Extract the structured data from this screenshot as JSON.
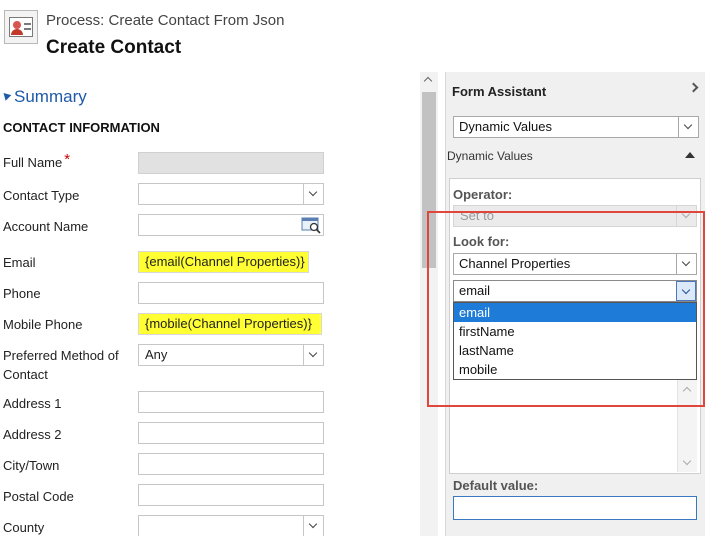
{
  "header": {
    "process_title": "Process: Create Contact From Json",
    "page_title": "Create Contact"
  },
  "summary": {
    "title": "Summary",
    "section_title": "CONTACT INFORMATION"
  },
  "fields": [
    {
      "label": "Full Name",
      "required": true,
      "type": "text",
      "value": "",
      "disabled": true
    },
    {
      "label": "Contact Type",
      "type": "select",
      "value": ""
    },
    {
      "label": "Account Name",
      "type": "lookup",
      "value": ""
    },
    {
      "label": "Email",
      "type": "text",
      "value": "{email(Channel Properties)}",
      "highlighted": true
    },
    {
      "label": "Phone",
      "type": "text",
      "value": ""
    },
    {
      "label": "Mobile Phone",
      "type": "text",
      "value": "{mobile(Channel Properties)}",
      "highlighted": true
    },
    {
      "label_line1": "Preferred Method of",
      "label_line2": "Contact",
      "type": "select",
      "value": "Any"
    },
    {
      "label": "Address 1",
      "type": "text",
      "value": ""
    },
    {
      "label": "Address 2",
      "type": "text",
      "value": ""
    },
    {
      "label": "City/Town",
      "type": "text",
      "value": ""
    },
    {
      "label": "Postal Code",
      "type": "text",
      "value": ""
    },
    {
      "label": "County",
      "type": "select",
      "value": ""
    }
  ],
  "form_assistant": {
    "title": "Form Assistant",
    "mode_value": "Dynamic Values",
    "section_title": "Dynamic Values",
    "operator_label": "Operator:",
    "operator_value": "Set to",
    "look_for_label": "Look for:",
    "look_for_value": "Channel Properties",
    "field_value": "email",
    "dropdown_options": [
      "email",
      "firstName",
      "lastName",
      "mobile"
    ],
    "selected_option": "email",
    "default_value_label": "Default value:",
    "default_value": ""
  },
  "colors": {
    "highlight": "#ffff33",
    "link_blue": "#1e5aa8",
    "selection_blue": "#1e7bd8",
    "annotation_red": "#e0473c"
  }
}
